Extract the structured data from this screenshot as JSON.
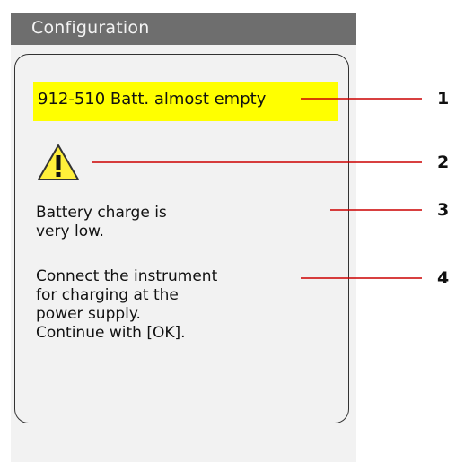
{
  "window": {
    "title": "Configuration"
  },
  "status": {
    "code_message": "912-510 Batt. almost empty"
  },
  "message": {
    "line1": "Battery charge is",
    "line2": "very low.",
    "line3": "Connect the instrument",
    "line4": "for charging at the",
    "line5": "power supply.",
    "line6": "Continue with [OK]."
  },
  "callouts": [
    "1",
    "2",
    "3",
    "4"
  ],
  "icons": {
    "warning": "warning-triangle-icon"
  },
  "colors": {
    "title_bar": "#6e6e6e",
    "highlight": "#ffff00",
    "callout_line": "#cc0000",
    "panel_bg": "#f2f2f2"
  }
}
